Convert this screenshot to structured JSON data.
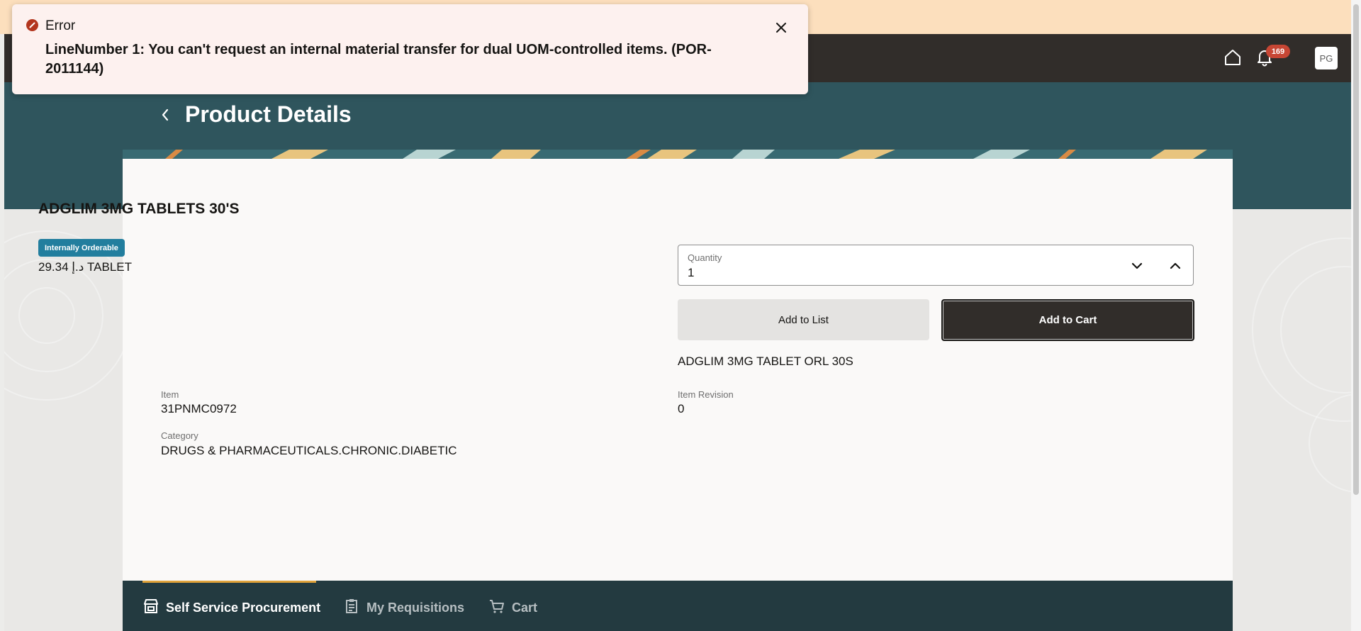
{
  "header": {
    "notification_count": "169",
    "avatar_initials": "PG"
  },
  "page": {
    "title": "Product Details"
  },
  "product": {
    "name": "ADGLIM 3MG TABLETS 30'S",
    "chip": "Internally Orderable",
    "price_line": "29.34 د.إ TABLET",
    "quantity_label": "Quantity",
    "quantity_value": "1",
    "add_to_list_label": "Add to List",
    "add_to_cart_label": "Add to Cart",
    "item_description": "ADGLIM 3MG TABLET ORL 30S",
    "attributes": {
      "item_label": "Item",
      "item_value": "31PNMC0972",
      "revision_label": "Item Revision",
      "revision_value": "0",
      "category_label": "Category",
      "category_value": "DRUGS & PHARMACEUTICALS.CHRONIC.DIABETIC"
    }
  },
  "bottom_nav": {
    "items": [
      {
        "label": "Self Service Procurement",
        "icon": "store-icon",
        "active": true
      },
      {
        "label": "My Requisitions",
        "icon": "clipboard-icon",
        "active": false
      },
      {
        "label": "Cart",
        "icon": "cart-icon",
        "active": false
      }
    ]
  },
  "toast": {
    "title": "Error",
    "message": "LineNumber 1: You can't request an internal material transfer for dual UOM-controlled items. (POR-2011144)"
  },
  "colors": {
    "header": "#312d2a",
    "teal_band": "#2f555d",
    "accent_chip": "#227e9e",
    "error": "#b3361e",
    "nav_bg": "#233a40",
    "nav_indicator": "#e0a33b",
    "badge": "#c74634"
  }
}
